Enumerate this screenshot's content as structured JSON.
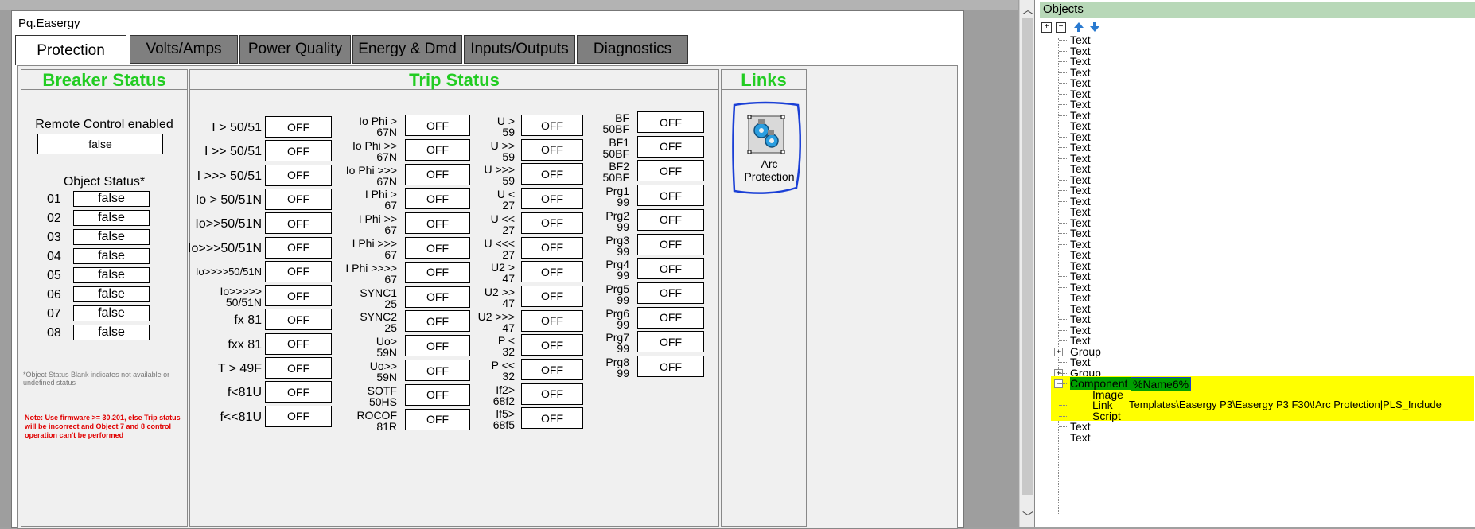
{
  "window_title": "Pq.Easergy",
  "tabs": [
    {
      "label": "Protection"
    },
    {
      "label": "Volts/Amps"
    },
    {
      "label": "Power Quality"
    },
    {
      "label": "Energy & Dmd"
    },
    {
      "label": "Inputs/Outputs"
    },
    {
      "label": "Diagnostics"
    }
  ],
  "breaker": {
    "title": "Breaker Status",
    "remote_label": "Remote Control enabled",
    "remote_value": "false",
    "object_status_label": "Object Status*",
    "objects": [
      {
        "num": "01",
        "value": "false"
      },
      {
        "num": "02",
        "value": "false"
      },
      {
        "num": "03",
        "value": "false"
      },
      {
        "num": "04",
        "value": "false"
      },
      {
        "num": "05",
        "value": "false"
      },
      {
        "num": "06",
        "value": "false"
      },
      {
        "num": "07",
        "value": "false"
      },
      {
        "num": "08",
        "value": "false"
      }
    ],
    "footnote": "*Object Status Blank indicates not available or undefined status",
    "note": "Note: Use firmware >= 30.201, else Trip status will be incorrect and Object 7 and 8 control operation can't be performed"
  },
  "trip": {
    "title": "Trip Status",
    "col1": [
      {
        "l1": "I > 50/51",
        "l2": "",
        "value": "OFF"
      },
      {
        "l1": "I >> 50/51",
        "l2": "",
        "value": "OFF"
      },
      {
        "l1": "I >>> 50/51",
        "l2": "",
        "value": "OFF"
      },
      {
        "l1": "Io > 50/51N",
        "l2": "",
        "value": "OFF"
      },
      {
        "l1": "Io>>50/51N",
        "l2": "",
        "value": "OFF"
      },
      {
        "l1": "Io>>>50/51N",
        "l2": "",
        "value": "OFF"
      },
      {
        "l1": "Io>>>>50/51N",
        "l2": "",
        "value": "OFF"
      },
      {
        "l1": "Io>>>>>",
        "l2": "50/51N",
        "value": "OFF"
      },
      {
        "l1": "fx 81",
        "l2": "",
        "value": "OFF"
      },
      {
        "l1": "fxx 81",
        "l2": "",
        "value": "OFF"
      },
      {
        "l1": "T > 49F",
        "l2": "",
        "value": "OFF"
      },
      {
        "l1": "f<81U",
        "l2": "",
        "value": "OFF"
      },
      {
        "l1": "f<<81U",
        "l2": "",
        "value": "OFF"
      }
    ],
    "col2": [
      {
        "l1": "Io Phi >",
        "l2": "67N",
        "value": "OFF"
      },
      {
        "l1": "Io Phi >>",
        "l2": "67N",
        "value": "OFF"
      },
      {
        "l1": "Io Phi >>>",
        "l2": "67N",
        "value": "OFF"
      },
      {
        "l1": "I Phi >",
        "l2": "67",
        "value": "OFF"
      },
      {
        "l1": "I Phi >>",
        "l2": "67",
        "value": "OFF"
      },
      {
        "l1": "I Phi >>>",
        "l2": "67",
        "value": "OFF"
      },
      {
        "l1": "I Phi >>>>",
        "l2": "67",
        "value": "OFF"
      },
      {
        "l1": "SYNC1",
        "l2": "25",
        "value": "OFF"
      },
      {
        "l1": "SYNC2",
        "l2": "25",
        "value": "OFF"
      },
      {
        "l1": "Uo>",
        "l2": "59N",
        "value": "OFF"
      },
      {
        "l1": "Uo>>",
        "l2": "59N",
        "value": "OFF"
      },
      {
        "l1": "SOTF",
        "l2": "50HS",
        "value": "OFF"
      },
      {
        "l1": "ROCOF",
        "l2": "81R",
        "value": "OFF"
      }
    ],
    "col3": [
      {
        "l1": "U >",
        "l2": "59",
        "value": "OFF"
      },
      {
        "l1": "U >>",
        "l2": "59",
        "value": "OFF"
      },
      {
        "l1": "U >>>",
        "l2": "59",
        "value": "OFF"
      },
      {
        "l1": "U <",
        "l2": "27",
        "value": "OFF"
      },
      {
        "l1": "U <<",
        "l2": "27",
        "value": "OFF"
      },
      {
        "l1": "U <<<",
        "l2": "27",
        "value": "OFF"
      },
      {
        "l1": "U2 >",
        "l2": "47",
        "value": "OFF"
      },
      {
        "l1": "U2 >>",
        "l2": "47",
        "value": "OFF"
      },
      {
        "l1": "U2 >>>",
        "l2": "47",
        "value": "OFF"
      },
      {
        "l1": "P <",
        "l2": "32",
        "value": "OFF"
      },
      {
        "l1": "P <<",
        "l2": "32",
        "value": "OFF"
      },
      {
        "l1": "If2>",
        "l2": "68f2",
        "value": "OFF"
      },
      {
        "l1": "If5>",
        "l2": "68f5",
        "value": "OFF"
      }
    ],
    "col4": [
      {
        "l1": "BF",
        "l2": "50BF",
        "value": "OFF"
      },
      {
        "l1": "BF1",
        "l2": "50BF",
        "value": "OFF"
      },
      {
        "l1": "BF2",
        "l2": "50BF",
        "value": "OFF"
      },
      {
        "l1": "Prg1",
        "l2": "99",
        "value": "OFF"
      },
      {
        "l1": "Prg2",
        "l2": "99",
        "value": "OFF"
      },
      {
        "l1": "Prg3",
        "l2": "99",
        "value": "OFF"
      },
      {
        "l1": "Prg4",
        "l2": "99",
        "value": "OFF"
      },
      {
        "l1": "Prg5",
        "l2": "99",
        "value": "OFF"
      },
      {
        "l1": "Prg6",
        "l2": "99",
        "value": "OFF"
      },
      {
        "l1": "Prg7",
        "l2": "99",
        "value": "OFF"
      },
      {
        "l1": "Prg8",
        "l2": "99",
        "value": "OFF"
      }
    ]
  },
  "links": {
    "title": "Links",
    "arc_line1": "Arc",
    "arc_line2": "Protection"
  },
  "objects_panel": {
    "title": "Objects",
    "toolbar_icons": [
      "expand-all-icon",
      "collapse-all-icon",
      "move-up-icon",
      "move-down-icon"
    ],
    "text_items": [
      "Text",
      "Text",
      "Text",
      "Text",
      "Text",
      "Text",
      "Text",
      "Text",
      "Text",
      "Text",
      "Text",
      "Text",
      "Text",
      "Text",
      "Text",
      "Text",
      "Text",
      "Text",
      "Text",
      "Text",
      "Text",
      "Text",
      "Text",
      "Text",
      "Text",
      "Text",
      "Text",
      "Text",
      "Text"
    ],
    "group1": "Group",
    "text_after_group1": "Text",
    "group2": "Group",
    "component": "Component",
    "component_name": "%Name6%",
    "child_image": "Image",
    "child_link": "Link",
    "link_value": "Templates\\Easergy P3\\Easergy P3 F30\\!Arc Protection|PLS_Include",
    "child_script": "Script",
    "trailing_text1": "Text",
    "trailing_text2": "Text"
  },
  "colors": {
    "title_green": "#22cc22",
    "highlight_yellow": "#ffff00",
    "selection_blue": "#1a3fd6",
    "note_red": "#e00000"
  }
}
